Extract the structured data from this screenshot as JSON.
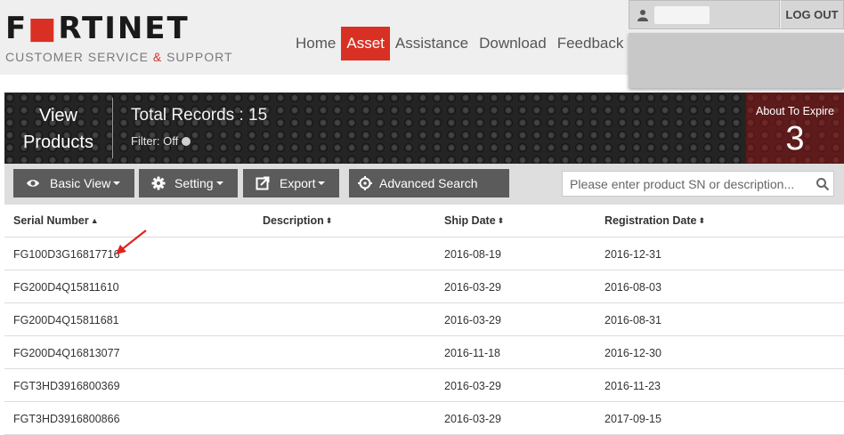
{
  "brand": {
    "wordmark_before": "F",
    "wordmark_o": "■",
    "wordmark_after": "RTINET",
    "sub_before": "CUSTOMER SERVICE ",
    "sub_amp": "&",
    "sub_after": " SUPPORT",
    "accent_color": "#d93024"
  },
  "nav": {
    "items": [
      {
        "label": "Home"
      },
      {
        "label": "Asset"
      },
      {
        "label": "Assistance"
      },
      {
        "label": "Download"
      },
      {
        "label": "Feedback"
      }
    ],
    "active": "Asset"
  },
  "user": {
    "icon": "user-icon",
    "logout_label": "LOG OUT"
  },
  "banner": {
    "view_line1": "View",
    "view_line2": "Products",
    "total_records": "Total Records : 15",
    "filter_label": "Filter: Off",
    "expire_label": "About To Expire",
    "expire_count": "3"
  },
  "toolbar": {
    "basic_view": "Basic View",
    "setting": "Setting",
    "export": "Export",
    "advanced_search": "Advanced Search",
    "search_placeholder": "Please enter product SN or description..."
  },
  "table": {
    "columns": [
      "Serial Number",
      "Description",
      "Ship Date",
      "Registration Date"
    ],
    "rows": [
      {
        "serial": "FG100D3G16817716",
        "description": "",
        "ship": "2016-08-19",
        "registration": "2016-12-31"
      },
      {
        "serial": "FG200D4Q15811610",
        "description": "",
        "ship": "2016-03-29",
        "registration": "2016-08-03"
      },
      {
        "serial": "FG200D4Q15811681",
        "description": "",
        "ship": "2016-03-29",
        "registration": "2016-08-31"
      },
      {
        "serial": "FG200D4Q16813077",
        "description": "",
        "ship": "2016-11-18",
        "registration": "2016-12-30"
      },
      {
        "serial": "FGT3HD3916800369",
        "description": "",
        "ship": "2016-03-29",
        "registration": "2016-11-23"
      },
      {
        "serial": "FGT3HD3916800866",
        "description": "",
        "ship": "2016-03-29",
        "registration": "2017-09-15"
      }
    ]
  }
}
